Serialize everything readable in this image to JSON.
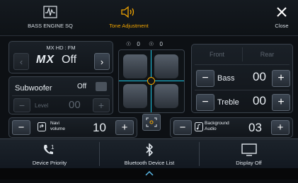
{
  "topbar": {
    "bass_engine": "BASS ENGINE SQ",
    "tone_adjustment": "Tone Adjustment",
    "close": "Close"
  },
  "mx": {
    "source": "MX HD : FM",
    "logo": "MX",
    "state": "Off"
  },
  "subwoofer": {
    "label": "Subwoofer",
    "state": "Off",
    "level_label": "Level",
    "level_value": "00"
  },
  "balance": {
    "front_value": "0",
    "rear_value": "0"
  },
  "tone": {
    "front_label": "Front",
    "rear_label": "Rear",
    "bass_label": "Bass",
    "bass_value": "00",
    "treble_label": "Treble",
    "treble_value": "00"
  },
  "navi_volume": {
    "label_line1": "Navi",
    "label_line2": "volume",
    "value": "10"
  },
  "background_audio": {
    "label_line1": "Background",
    "label_line2": "Audio",
    "value": "03"
  },
  "bottombar": {
    "device_priority": "Device Priority",
    "bluetooth_list": "Bluetooth Device List",
    "display_off": "Display Off"
  },
  "colors": {
    "accent": "#f0a400",
    "crosshair": "#1ec8e6",
    "text": "#e9eef3"
  }
}
